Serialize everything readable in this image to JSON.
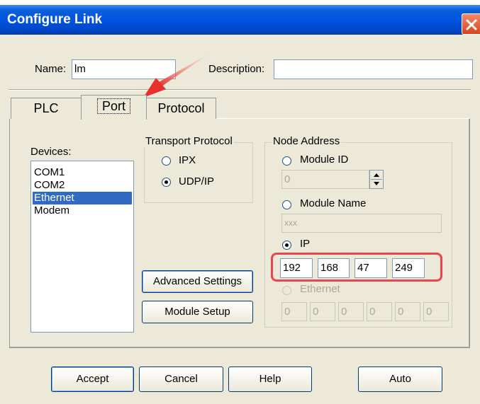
{
  "window": {
    "title": "Configure Link"
  },
  "header": {
    "name_label": "Name:",
    "name_value": "lm",
    "description_label": "Description:",
    "description_value": ""
  },
  "tabs": [
    {
      "label": "PLC"
    },
    {
      "label": "Port",
      "active": true
    },
    {
      "label": "Protocol"
    }
  ],
  "devices": {
    "label": "Devices:",
    "items": [
      "COM1",
      "COM2",
      "Ethernet",
      "Modem"
    ],
    "selected": "Ethernet"
  },
  "transport": {
    "title": "Transport Protocol",
    "options": [
      {
        "label": "IPX",
        "selected": false
      },
      {
        "label": "UDP/IP",
        "selected": true
      }
    ]
  },
  "node": {
    "title": "Node Address",
    "module_id_label": "Module ID",
    "module_id_value": "0",
    "module_name_label": "Module Name",
    "module_name_value": "xxx",
    "ip_label": "IP",
    "ip_octets": [
      "192",
      "168",
      "47",
      "249"
    ],
    "ethernet_label": "Ethernet",
    "ethernet_octets": [
      "0",
      "0",
      "0",
      "0",
      "0",
      "0"
    ]
  },
  "buttons": {
    "advanced": "Advanced Settings",
    "module_setup": "Module Setup",
    "accept": "Accept",
    "cancel": "Cancel",
    "help": "Help",
    "auto": "Auto"
  },
  "colors": {
    "title_bar": "#0054e3",
    "selection": "#316ac5",
    "annotation": "#e8464c"
  }
}
